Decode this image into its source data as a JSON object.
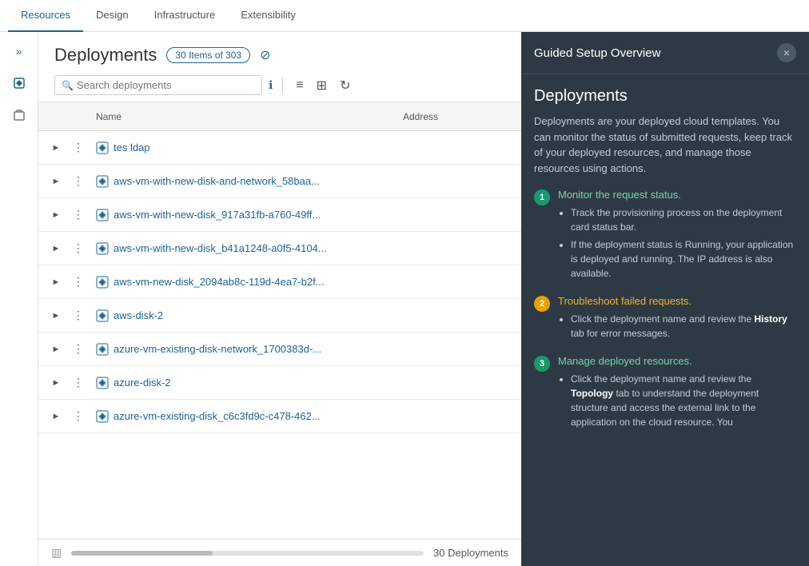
{
  "nav": {
    "tabs": [
      {
        "label": "Resources",
        "active": true
      },
      {
        "label": "Design",
        "active": false
      },
      {
        "label": "Infrastructure",
        "active": false
      },
      {
        "label": "Extensibility",
        "active": false
      }
    ]
  },
  "sidebar": {
    "collapse_icon": "»",
    "icons": [
      {
        "name": "diamond-icon",
        "symbol": "◇",
        "active": false
      },
      {
        "name": "cube-icon",
        "symbol": "⬡",
        "active": false
      }
    ]
  },
  "deployments": {
    "title": "Deployments",
    "items_badge": "30 Items of 303",
    "search_placeholder": "Search deployments",
    "toolbar": {
      "info_label": "ℹ",
      "list_view_label": "≡",
      "grid_view_label": "⊞",
      "refresh_label": "↻"
    },
    "table": {
      "columns": [
        {
          "key": "name",
          "label": "Name"
        },
        {
          "key": "address",
          "label": "Address"
        }
      ],
      "rows": [
        {
          "name": "tes ldap",
          "address": ""
        },
        {
          "name": "aws-vm-with-new-disk-and-network_58baa...",
          "address": ""
        },
        {
          "name": "aws-vm-with-new-disk_917a31fb-a760-49ff...",
          "address": ""
        },
        {
          "name": "aws-vm-with-new-disk_b41a1248-a0f5-4104...",
          "address": ""
        },
        {
          "name": "aws-vm-new-disk_2094ab8c-119d-4ea7-b2f...",
          "address": ""
        },
        {
          "name": "aws-disk-2",
          "address": ""
        },
        {
          "name": "azure-vm-existing-disk-network_1700383d-...",
          "address": ""
        },
        {
          "name": "azure-disk-2",
          "address": ""
        },
        {
          "name": "azure-vm-existing-disk_c6c3fd9c-c478-462...",
          "address": ""
        }
      ]
    },
    "footer": {
      "count_label": "30 Deployments"
    }
  },
  "panel": {
    "title": "Guided Setup Overview",
    "close_label": "×",
    "section_title": "Deployments",
    "description": "Deployments are your deployed cloud templates. You can monitor the status of submitted requests, keep track of your deployed resources, and manage those resources using actions.",
    "steps": [
      {
        "number": "1",
        "color": "teal",
        "title": "Monitor the request status.",
        "title_color": "teal",
        "bullets": [
          "Track the provisioning process on the deployment card status bar.",
          "If the deployment status is Running, your application is deployed and running. The IP address is also available."
        ]
      },
      {
        "number": "2",
        "color": "yellow",
        "title": "Troubleshoot failed requests.",
        "title_color": "yellow",
        "bullets": [
          "Click the deployment name and review the **History** tab for error messages."
        ]
      },
      {
        "number": "3",
        "color": "teal",
        "title": "Manage deployed resources.",
        "title_color": "teal",
        "bullets": [
          "Click the deployment name and review the **Topology** tab to understand the deployment structure and access the external link to the application on the cloud resource. You"
        ]
      }
    ]
  }
}
